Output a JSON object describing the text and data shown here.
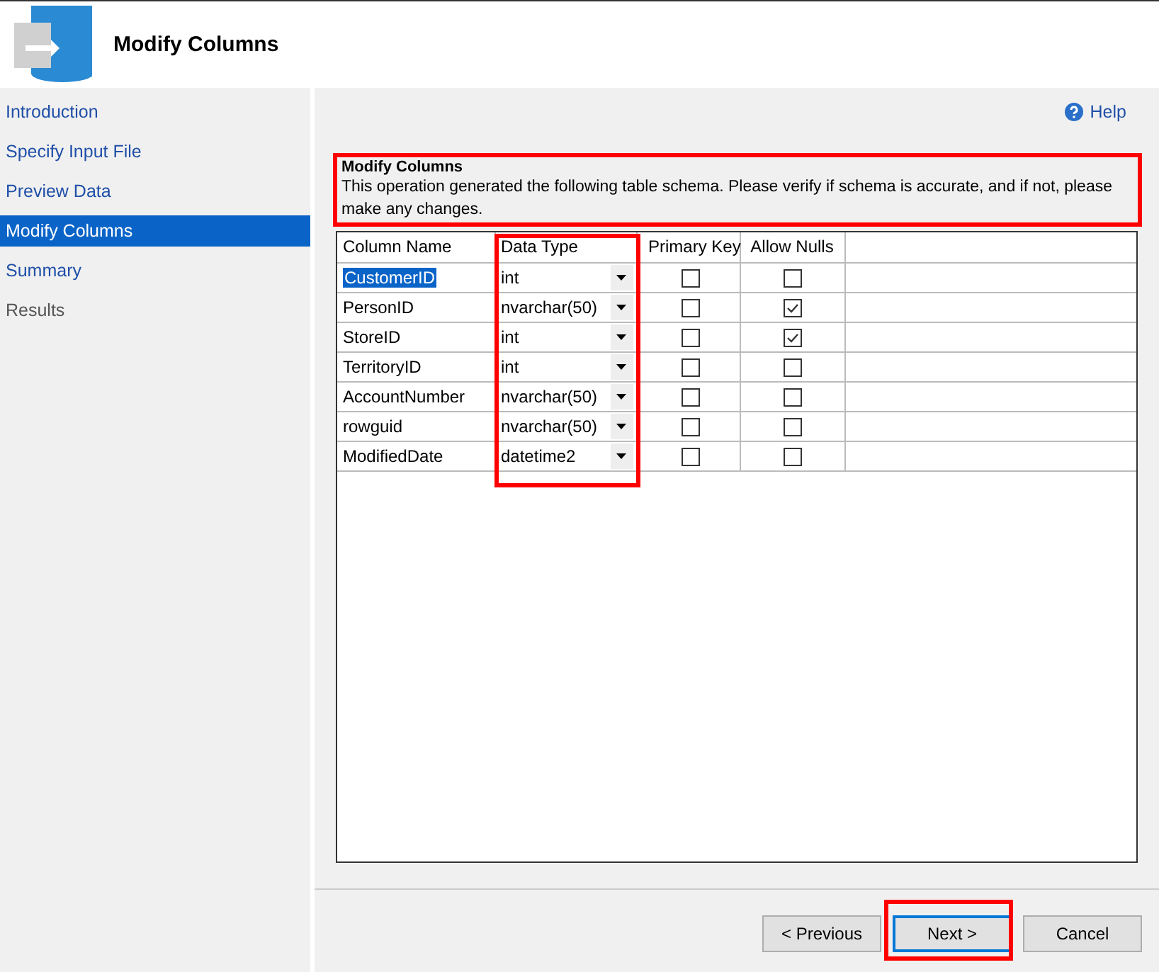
{
  "header": {
    "title": "Modify Columns"
  },
  "sidebar": {
    "items": [
      {
        "label": "Introduction",
        "selected": false,
        "disabled": false
      },
      {
        "label": "Specify Input File",
        "selected": false,
        "disabled": false
      },
      {
        "label": "Preview Data",
        "selected": false,
        "disabled": false
      },
      {
        "label": "Modify Columns",
        "selected": true,
        "disabled": false
      },
      {
        "label": "Summary",
        "selected": false,
        "disabled": false
      },
      {
        "label": "Results",
        "selected": false,
        "disabled": true
      }
    ]
  },
  "help": {
    "label": "Help"
  },
  "section": {
    "title": "Modify Columns",
    "description": "This operation generated the following table schema. Please verify if schema is accurate, and if not, please make any changes."
  },
  "table": {
    "columns": [
      "Column Name",
      "Data Type",
      "Primary Key",
      "Allow Nulls"
    ],
    "rows": [
      {
        "name": "CustomerID",
        "type": "int",
        "primary_key": false,
        "allow_nulls": false,
        "selected": true
      },
      {
        "name": "PersonID",
        "type": "nvarchar(50)",
        "primary_key": false,
        "allow_nulls": true,
        "selected": false
      },
      {
        "name": "StoreID",
        "type": "int",
        "primary_key": false,
        "allow_nulls": true,
        "selected": false
      },
      {
        "name": "TerritoryID",
        "type": "int",
        "primary_key": false,
        "allow_nulls": false,
        "selected": false
      },
      {
        "name": "AccountNumber",
        "type": "nvarchar(50)",
        "primary_key": false,
        "allow_nulls": false,
        "selected": false
      },
      {
        "name": "rowguid",
        "type": "nvarchar(50)",
        "primary_key": false,
        "allow_nulls": false,
        "selected": false
      },
      {
        "name": "ModifiedDate",
        "type": "datetime2",
        "primary_key": false,
        "allow_nulls": false,
        "selected": false
      }
    ]
  },
  "buttons": [
    {
      "label": "< Previous",
      "default": false
    },
    {
      "label": "Next >",
      "default": true
    },
    {
      "label": "Cancel",
      "default": false
    }
  ]
}
